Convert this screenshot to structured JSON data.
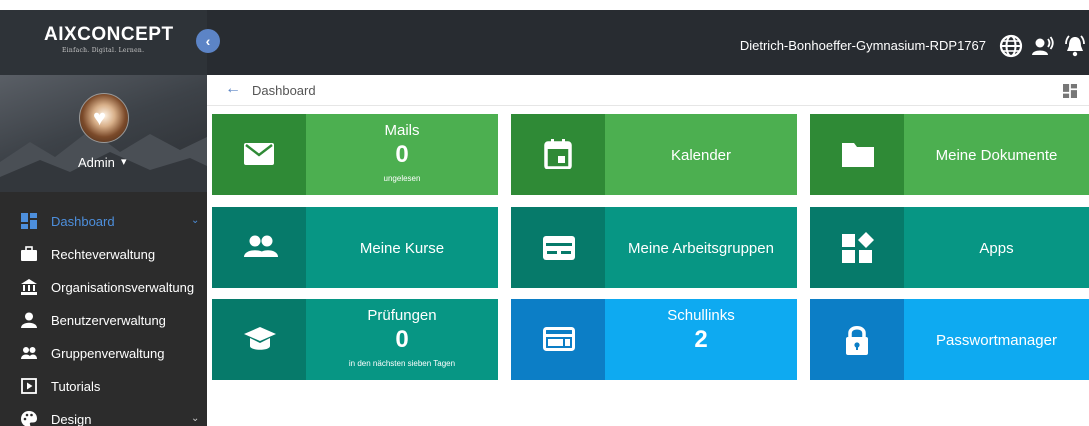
{
  "header": {
    "logo": "AIXCONCEPT",
    "logo_tagline": "Einfach. Digital. Lernen.",
    "school": "Dietrich-Bonhoeffer-Gymnasium-RDP1767",
    "colors": {
      "bar": "#282c31",
      "collapse": "#5c84c6"
    }
  },
  "sidebar": {
    "user": "Admin",
    "items": [
      {
        "label": "Dashboard",
        "icon": "dashboard-icon",
        "active": true
      },
      {
        "label": "Rechteverwaltung",
        "icon": "briefcase-icon"
      },
      {
        "label": "Organisationsverwaltung",
        "icon": "bank-icon"
      },
      {
        "label": "Benutzerverwaltung",
        "icon": "person-icon"
      },
      {
        "label": "Gruppenverwaltung",
        "icon": "group-icon"
      },
      {
        "label": "Tutorials",
        "icon": "play-icon"
      },
      {
        "label": "Design",
        "icon": "palette-icon"
      }
    ]
  },
  "breadcrumb": {
    "label": "Dashboard"
  },
  "tiles": {
    "mails": {
      "title": "Mails",
      "count": "0",
      "sub": "ungelesen"
    },
    "kalender": {
      "label": "Kalender"
    },
    "dokumente": {
      "label": "Meine Dokumente"
    },
    "kurse": {
      "label": "Meine Kurse"
    },
    "arbeitsgruppen": {
      "label": "Meine Arbeitsgruppen"
    },
    "apps": {
      "label": "Apps"
    },
    "pruefungen": {
      "title": "Prüfungen",
      "count": "0",
      "sub": "in den nächsten sieben Tagen"
    },
    "schullinks": {
      "title": "Schullinks",
      "count": "2"
    },
    "passwort": {
      "label": "Passwortmanager"
    }
  },
  "colors": {
    "green_dark": "#2f8a36",
    "green": "#4caf50",
    "teal_dark": "#067a6a",
    "teal": "#079684",
    "blue_dark": "#0c7ec6",
    "blue": "#0eaaf1"
  }
}
